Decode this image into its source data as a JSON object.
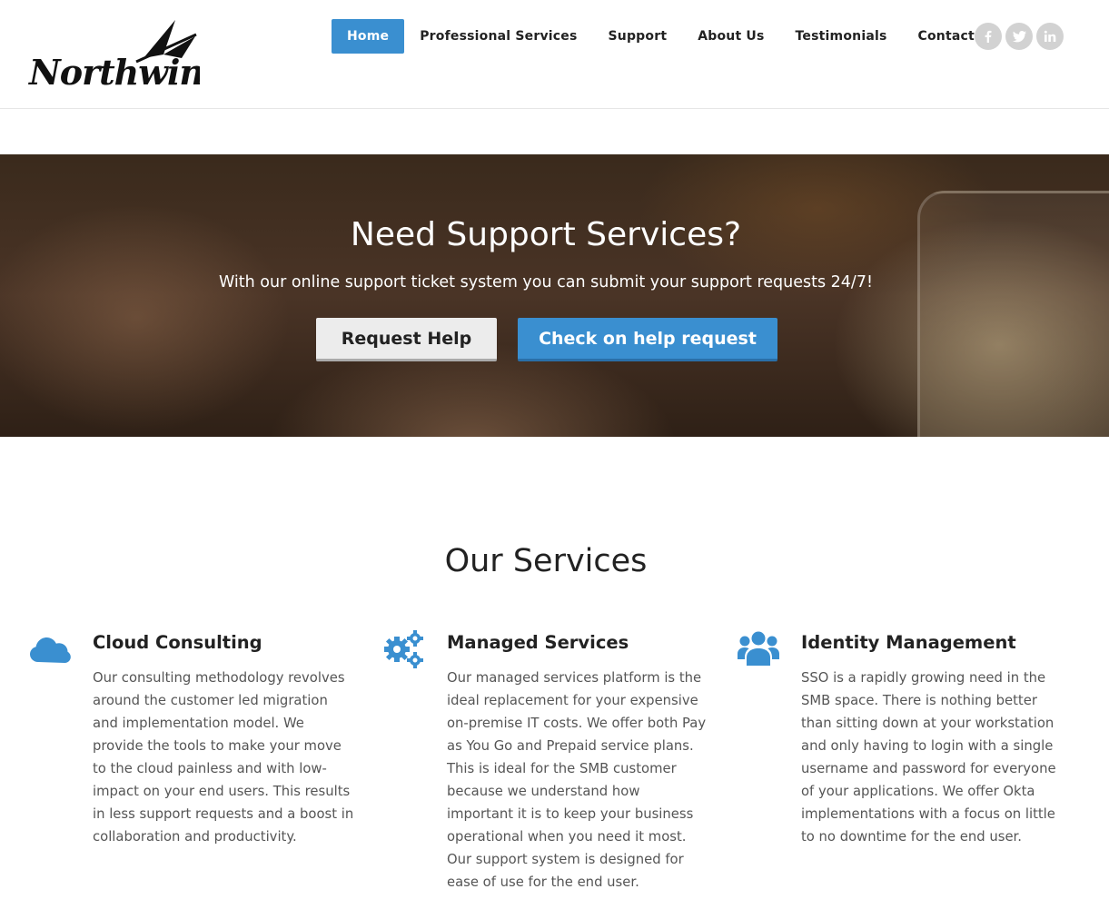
{
  "brand": {
    "logo_text": "Northwind"
  },
  "nav": {
    "items": [
      {
        "label": "Home",
        "active": true
      },
      {
        "label": "Professional Services",
        "active": false
      },
      {
        "label": "Support",
        "active": false
      },
      {
        "label": "About Us",
        "active": false
      },
      {
        "label": "Testimonials",
        "active": false
      },
      {
        "label": "Contact",
        "active": false
      }
    ]
  },
  "social": {
    "icons": [
      "facebook-icon",
      "twitter-icon",
      "linkedin-icon"
    ]
  },
  "hero": {
    "title": "Need Support Services?",
    "subtitle": "With our online support ticket system you can submit your support requests 24/7!",
    "primary_button": "Request Help",
    "secondary_button": "Check on help request"
  },
  "services": {
    "title": "Our Services",
    "items": [
      {
        "icon": "cloud-icon",
        "title": "Cloud Consulting",
        "text": "Our consulting methodology revolves around the customer led migration and implementation model. We provide the tools to make your move to the cloud painless and with low-impact on your end users. This results in less support requests and a boost in collaboration and productivity."
      },
      {
        "icon": "gears-icon",
        "title": "Managed Services",
        "text": "Our managed services platform is the ideal replacement for your expensive on-premise IT costs. We offer both Pay as You Go and Prepaid service plans. This is ideal for the SMB customer because we understand how important it is to keep your business operational when you need it most. Our support system is designed for ease of use for the end user."
      },
      {
        "icon": "users-icon",
        "title": "Identity Management",
        "text": "SSO is a rapidly growing need in the SMB space. There is nothing better than sitting down at your workstation and only having to login with a single username and password for everyone of your applications. We offer Okta implementations with a focus on little to no downtime for the end user."
      }
    ]
  },
  "colors": {
    "accent": "#3a8fd0",
    "text": "#222222",
    "muted": "#555555",
    "social_bg": "#d2d2d2"
  }
}
